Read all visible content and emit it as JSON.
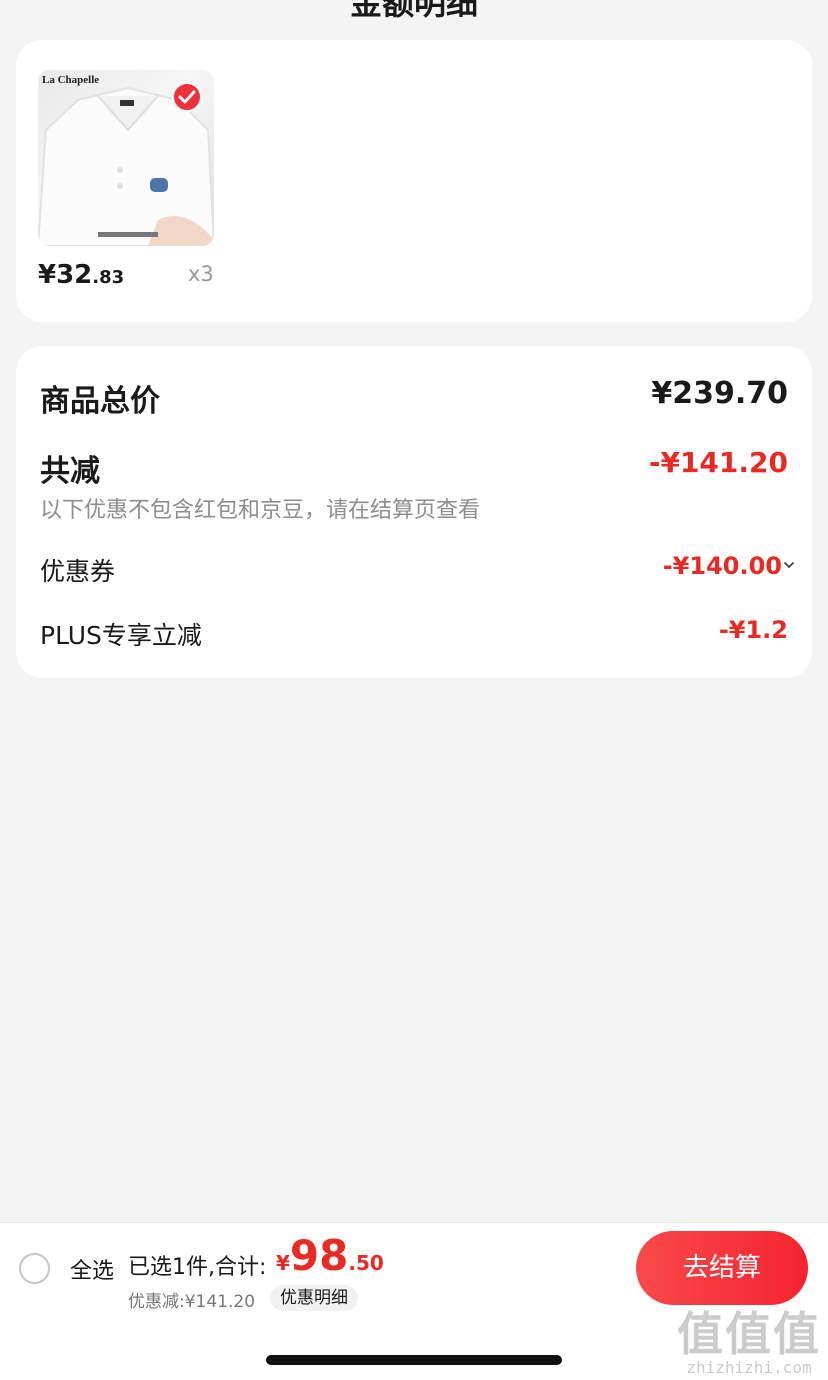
{
  "header": {
    "title": "金额明细"
  },
  "product": {
    "brand": "La Chapelle",
    "price_int": "¥32",
    "price_cents": ".83",
    "quantity": "x3"
  },
  "summary": {
    "total_label": "商品总价",
    "total_value": "¥239.70",
    "reduce_label": "共减",
    "reduce_value": "-¥141.20",
    "note": "以下优惠不包含红包和京豆，请在结算页查看",
    "coupon_label": "优惠券",
    "coupon_value": "-¥140.00",
    "plus_label": "PLUS专享立减",
    "plus_value": "-¥1.2"
  },
  "bottom_bar": {
    "select_all": "全选",
    "selected_info": "已选1件,合计:",
    "sum_yen": "¥",
    "sum_int": "98",
    "sum_cents": ".50",
    "discount": "优惠减:¥141.20",
    "detail_label": "优惠明细",
    "checkout_label": "去结算"
  },
  "watermark": {
    "logo": "值值值",
    "url": "zhizhizhi.com"
  },
  "colors": {
    "accent": "#e92a24",
    "checkout": "#f5232f",
    "background": "#f4f4f4"
  }
}
